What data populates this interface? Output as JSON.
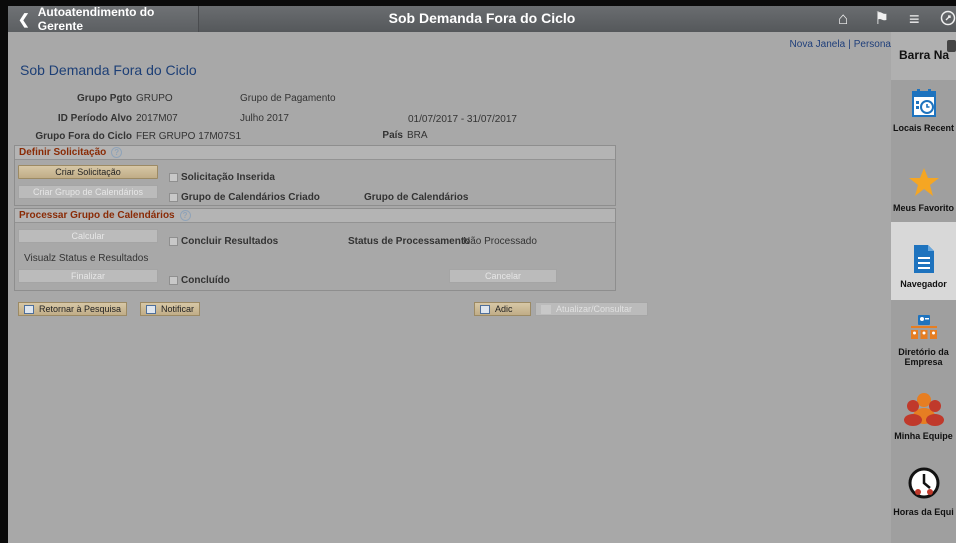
{
  "header": {
    "back_label": "Autoatendimento do Gerente",
    "page_title": "Sob Demanda Fora do Ciclo"
  },
  "links": {
    "new_window": "Nova Janela",
    "personalize": "Persona"
  },
  "page": {
    "title": "Sob Demanda Fora do Ciclo"
  },
  "fields": {
    "grupo_pgto_label": "Grupo Pgto",
    "grupo_pgto_value": "GRUPO",
    "grupo_pgto_desc": "Grupo de Pagamento",
    "periodo_label": "ID Período Alvo",
    "periodo_value": "2017M07",
    "periodo_desc": "Julho 2017",
    "periodo_range": "01/07/2017 - 31/07/2017",
    "fora_ciclo_label": "Grupo Fora do Ciclo",
    "fora_ciclo_value": "FER GRUPO 17M07S1",
    "pais_label": "País",
    "pais_value": "BRA"
  },
  "definir": {
    "heading": "Definir Solicitação",
    "criar_solicitacao": "Criar Solicitação",
    "criar_grupo": "Criar Grupo de Calendários",
    "solicitacao_inserida": "Solicitação Inserida",
    "grupo_criado": "Grupo de Calendários Criado",
    "grupo_label": "Grupo de Calendários"
  },
  "processar": {
    "heading": "Processar Grupo de Calendários",
    "calcular": "Calcular",
    "concluir_resultados": "Concluir Resultados",
    "status_label": "Status de Processamento",
    "status_value": "Não Processado",
    "visualz": "Visualz Status e Resultados",
    "finalizar": "Finalizar",
    "concluido": "Concluído",
    "cancelar": "Cancelar"
  },
  "bottom": {
    "retornar": "Retornar à Pesquisa",
    "notificar": "Notificar",
    "adic": "Adic",
    "atualizar": "Atualizar/Consultar"
  },
  "navbar": {
    "title": "Barra Na",
    "items": [
      {
        "label": "Locais Recent",
        "icon": "calendar-clock-icon"
      },
      {
        "label": "Meus Favorito",
        "icon": "star-icon"
      },
      {
        "label": "Navegador",
        "icon": "document-icon"
      },
      {
        "label": "Diretório da",
        "label2": "Empresa",
        "icon": "org-chart-icon"
      },
      {
        "label": "Minha Equipe",
        "icon": "team-icon"
      },
      {
        "label": "Horas da Equi",
        "icon": "team-clock-icon"
      }
    ]
  },
  "colors": {
    "accent_title": "#1d3f76",
    "section_heading": "#8a2b06",
    "star": "#f5a623",
    "nav_icon_blue": "#1e73be",
    "team_red": "#c0392b",
    "team_orange": "#e67e22"
  }
}
